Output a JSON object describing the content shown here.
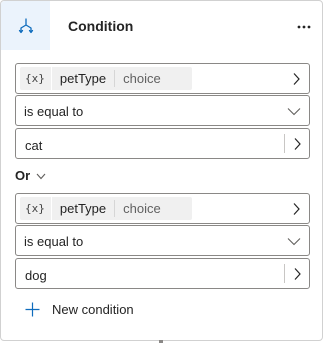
{
  "header": {
    "title": "Condition",
    "icon": "branch-icon",
    "more_icon": "more-icon"
  },
  "conditions": [
    {
      "variable_glyph": "{x}",
      "variable_name": "petType",
      "variable_type": "choice",
      "operator": "is equal to",
      "value": "cat"
    },
    {
      "variable_glyph": "{x}",
      "variable_name": "petType",
      "variable_type": "choice",
      "operator": "is equal to",
      "value": "dog"
    }
  ],
  "join": {
    "label": "Or"
  },
  "add_condition": {
    "label": "New condition"
  },
  "colors": {
    "header_icon_bg": "#ebf3fc",
    "accent": "#0f6cbd",
    "border": "#8a8886"
  }
}
